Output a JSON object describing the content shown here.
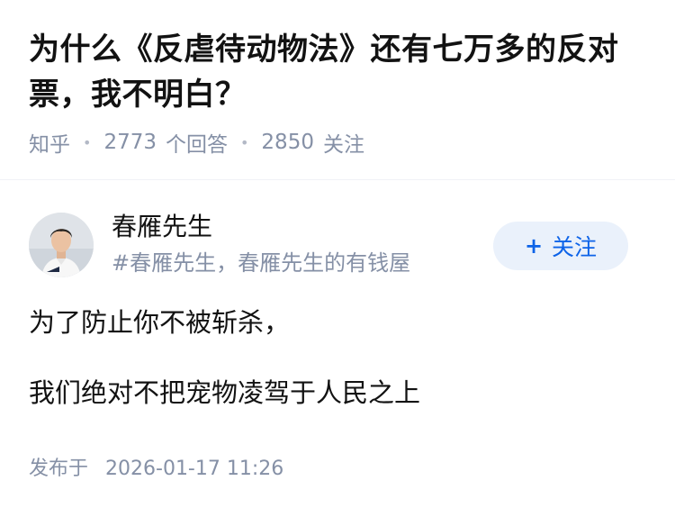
{
  "question": {
    "title": "为什么《反虐待动物法》还有七万多的反对票，我不明白？",
    "source": "知乎",
    "answer_count": "2773",
    "answer_label": "个回答",
    "follow_count": "2850",
    "follow_label": "关注"
  },
  "author": {
    "name": "春雁先生",
    "headline": "#春雁先生，春雁先生的有钱屋",
    "follow_button": "关注",
    "follow_icon": "plus-icon"
  },
  "answer": {
    "paragraphs": [
      "为了防止你不被斩杀，",
      "我们绝对不把宠物凌驾于人民之上"
    ],
    "published_label": "发布于",
    "published_time": "2026-01-17 11:26"
  },
  "colors": {
    "title": "#121212",
    "meta": "#8590a6",
    "accent": "#0d63e8",
    "follow_bg": "#eaf1fb"
  }
}
